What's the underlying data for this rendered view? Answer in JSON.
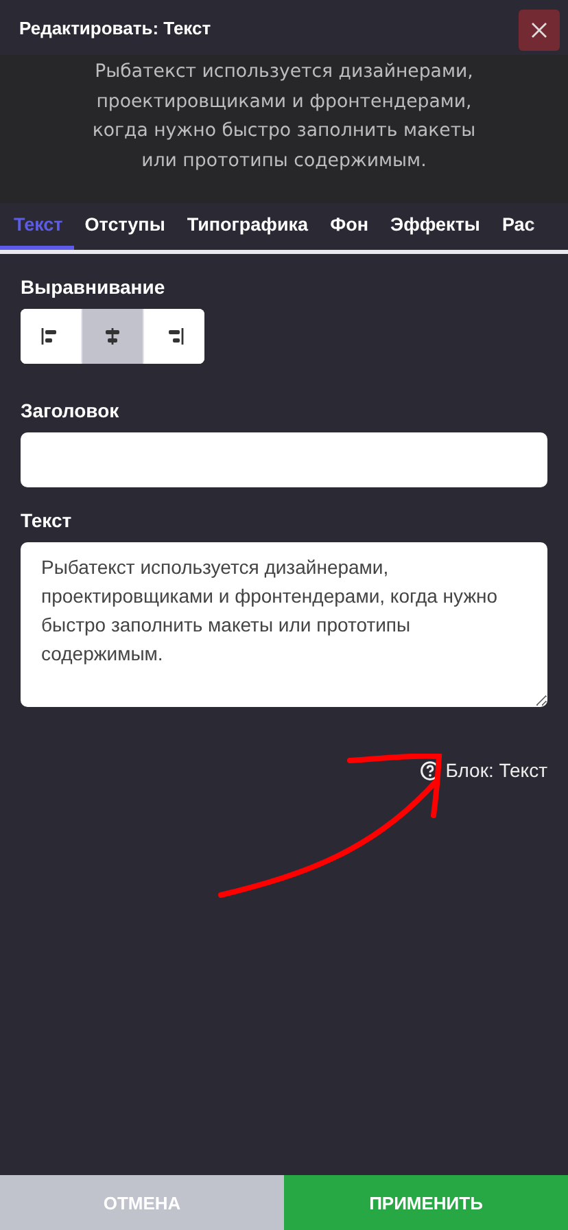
{
  "window": {
    "title": "Редактировать: Текст"
  },
  "preview": {
    "text": "Рыбатекст используется дизайнерами, проектировщиками и фронтендерами, когда нужно быстро заполнить макеты или прототипы содержимым."
  },
  "tabs": [
    {
      "label": "Текст",
      "selected": true
    },
    {
      "label": "Отступы",
      "selected": false
    },
    {
      "label": "Типографика",
      "selected": false
    },
    {
      "label": "Фон",
      "selected": false
    },
    {
      "label": "Эффекты",
      "selected": false
    },
    {
      "label": "Рас",
      "selected": false
    }
  ],
  "alignment": {
    "label": "Выравнивание",
    "options": [
      {
        "kind": "left",
        "selected": false
      },
      {
        "kind": "center",
        "selected": true
      },
      {
        "kind": "right",
        "selected": false
      }
    ]
  },
  "heading_field": {
    "label": "Заголовок"
  },
  "text_field": {
    "label": "Текст",
    "value": "Рыбатекст используется дизайнерами, проектировщиками и фронтендерами, когда нужно быстро заполнить макеты или прототипы содержимым."
  },
  "block_info": {
    "text": "Блок: Текст"
  },
  "buttons": [
    {
      "kind": "cancel",
      "label": "ОТМЕНА"
    },
    {
      "kind": "apply",
      "label": "ПРИМЕНИТЬ"
    }
  ]
}
